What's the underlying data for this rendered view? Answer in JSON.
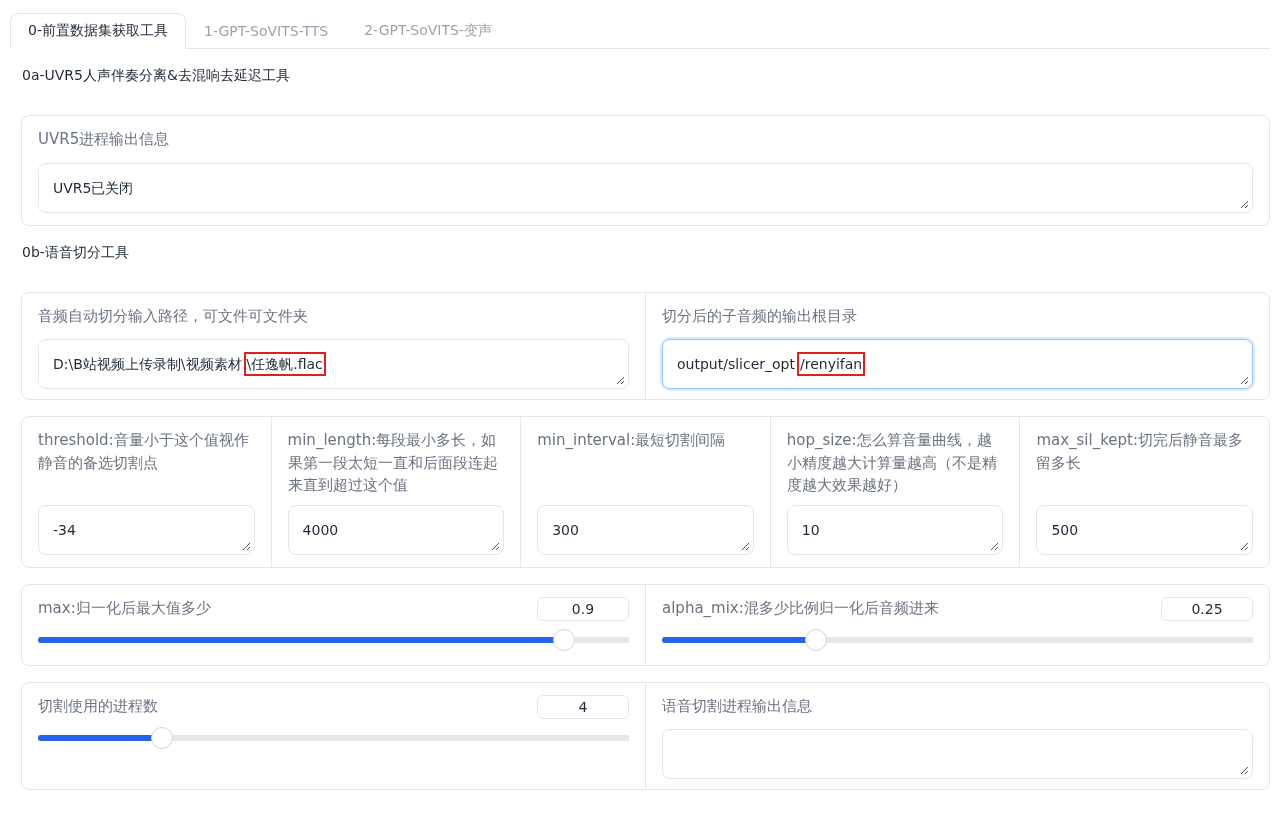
{
  "tabs": [
    {
      "label": "0-前置数据集获取工具",
      "selected": true
    },
    {
      "label": "1-GPT-SoVITS-TTS",
      "selected": false
    },
    {
      "label": "2-GPT-SoVITS-变声",
      "selected": false
    }
  ],
  "uvr5": {
    "heading": "0a-UVR5人声伴奏分离&去混响去延迟工具",
    "output_label": "UVR5进程输出信息",
    "output_value": "UVR5已关闭"
  },
  "slicer": {
    "heading": "0b-语音切分工具",
    "paths": [
      {
        "label": "音频自动切分输入路径，可文件可文件夹",
        "focused": false,
        "value_parts": [
          {
            "text": "D:\\B站视频上传录制\\视频素材",
            "marked": false
          },
          {
            "text": "\\任逸帆.flac",
            "marked": true
          }
        ]
      },
      {
        "label": "切分后的子音频的输出根目录",
        "focused": true,
        "value_parts": [
          {
            "text": "output/slicer_opt",
            "marked": false
          },
          {
            "text": "/renyifan",
            "marked": true
          }
        ]
      }
    ],
    "params": [
      {
        "label": "threshold:音量小于这个值视作静音的备选切割点",
        "value": "-34"
      },
      {
        "label": "min_length:每段最小多长，如果第一段太短一直和后面段连起来直到超过这个值",
        "value": "4000"
      },
      {
        "label": "min_interval:最短切割间隔",
        "value": "300"
      },
      {
        "label": "hop_size:怎么算音量曲线，越小精度越大计算量越高（不是精度越大效果越好）",
        "value": "10"
      },
      {
        "label": "max_sil_kept:切完后静音最多留多长",
        "value": "500"
      }
    ],
    "sliders": [
      {
        "label": "max:归一化后最大值多少",
        "reading": "0.9",
        "level": 0.89
      },
      {
        "label": "alpha_mix:混多少比例归一化后音频进来",
        "reading": "0.25",
        "level": 0.26
      }
    ],
    "processes": {
      "label": "切割使用的进程数",
      "reading": "4",
      "level": 0.21
    },
    "output_label": "语音切割进程输出信息"
  }
}
